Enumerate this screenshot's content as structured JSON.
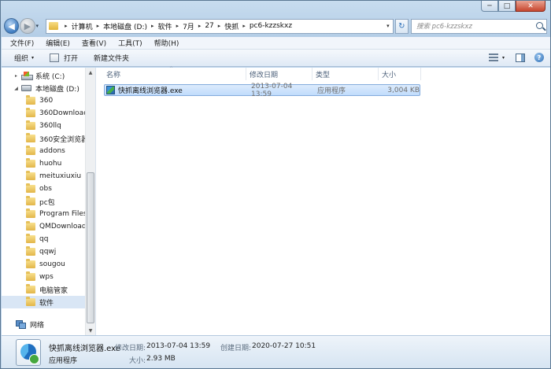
{
  "window": {
    "caption_buttons": {
      "minimize": "─",
      "maximize": "□",
      "close": "✕"
    }
  },
  "nav": {
    "back_symbol": "◀",
    "forward_symbol": "▶",
    "history_drop": "▾",
    "breadcrumbs": [
      "计算机",
      "本地磁盘 (D:)",
      "软件",
      "7月",
      "27",
      "快抓",
      "pc6-kzzskxz"
    ],
    "crumb_separator": "▸",
    "address_drop": "▾",
    "refresh_symbol": "↻",
    "search_placeholder": "搜索 pc6-kzzskxz"
  },
  "menu": {
    "items": [
      "文件(F)",
      "编辑(E)",
      "查看(V)",
      "工具(T)",
      "帮助(H)"
    ]
  },
  "toolbar": {
    "organize_label": "组织",
    "open_label": "打开",
    "new_folder_label": "新建文件夹",
    "dropdown_symbol": "▾",
    "help_symbol": "?"
  },
  "sidebar": {
    "system_drive": "系统 (C:)",
    "local_drive": "本地磁盘 (D:)",
    "folders": [
      "360",
      "360Downloads",
      "360llq",
      "360安全浏览器",
      "addons",
      "huohu",
      "meituxiuxiu",
      "obs",
      "pc包",
      "Program Files",
      "QMDownload",
      "qq",
      "qqwj",
      "sougou",
      "wps",
      "电脑管家",
      "软件"
    ],
    "selected_folder": "软件",
    "network": "网络",
    "expand_symbol": "▸",
    "collapse_symbol": "◢"
  },
  "file_list": {
    "columns": {
      "name": "名称",
      "date": "修改日期",
      "type": "类型",
      "size": "大小"
    },
    "sort_indicator": "^",
    "files": [
      {
        "name": "快抓离线浏览器.exe",
        "date": "2013-07-04 13:59",
        "type": "应用程序",
        "size": "3,004 KB"
      }
    ]
  },
  "details": {
    "file_name": "快抓离线浏览器.exe",
    "file_type": "应用程序",
    "modified_label": "修改日期:",
    "modified_value": "2013-07-04 13:59",
    "created_label": "创建日期:",
    "created_value": "2020-07-27 10:51",
    "size_label": "大小:",
    "size_value": "2.93 MB"
  },
  "scrollbar": {
    "up": "▲",
    "down": "▼"
  }
}
